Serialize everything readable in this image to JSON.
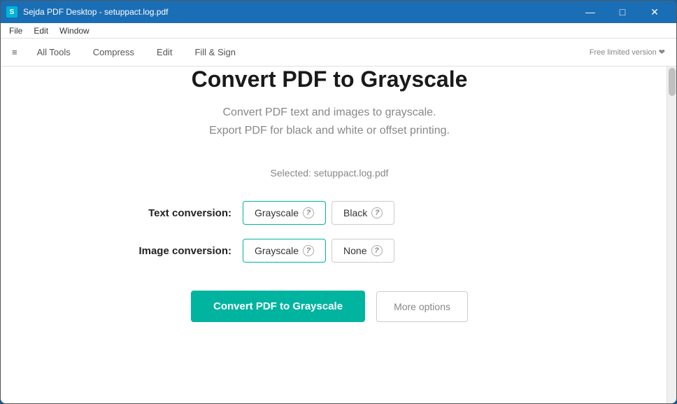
{
  "titlebar": {
    "icon_label": "S",
    "title": "Sejda PDF Desktop - setuppact.log.pdf",
    "minimize_label": "—",
    "maximize_label": "□",
    "close_label": "✕"
  },
  "menubar": {
    "items": [
      "File",
      "Edit",
      "Window"
    ]
  },
  "navbar": {
    "hamburger": "≡",
    "all_tools": "All Tools",
    "compress": "Compress",
    "edit": "Edit",
    "fill_sign": "Fill & Sign",
    "promo": "Free limited version ❤"
  },
  "page": {
    "title": "Convert PDF to Grayscale",
    "subtitle_line1": "Convert PDF text and images to grayscale.",
    "subtitle_line2": "Export PDF for black and white or offset printing.",
    "selected_label": "Selected: setuppact.log.pdf",
    "text_conversion_label": "Text conversion:",
    "image_conversion_label": "Image conversion:",
    "text_option1": "Grayscale",
    "text_option2": "Black",
    "image_option1": "Grayscale",
    "image_option2": "None",
    "convert_btn": "Convert PDF to Grayscale",
    "more_options_btn": "More options"
  }
}
